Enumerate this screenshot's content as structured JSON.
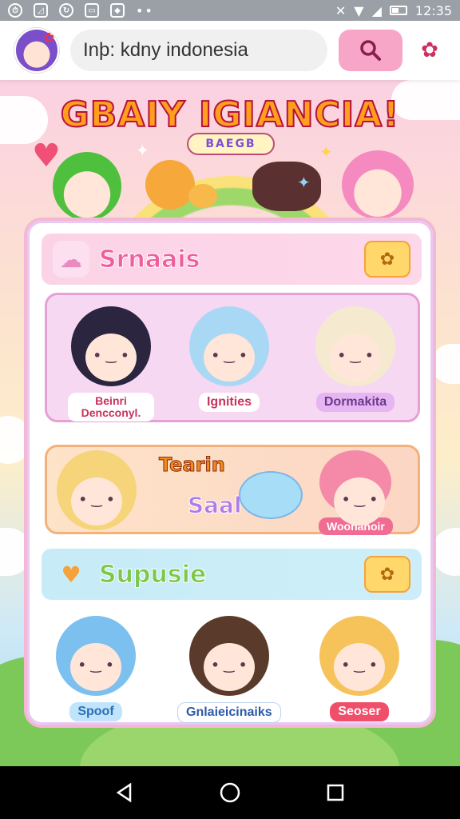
{
  "status_bar": {
    "time": "12:35",
    "icons": [
      "clock-icon",
      "gallery-icon",
      "sync-icon",
      "message-icon",
      "shield-icon",
      "more-dots-icon",
      "vibrate-icon",
      "wifi-icon",
      "signal-icon",
      "battery-icon"
    ]
  },
  "header": {
    "search_text": "Inþ: kdny indonesia",
    "search_icon": "search-icon",
    "settings_icon": "flower-gear-icon"
  },
  "banner": {
    "title": "GBAIY IGIANCIA!",
    "subtitle": "BAEGB"
  },
  "section1": {
    "title": "Srnaais",
    "characters": [
      {
        "name": "Beinri Dencconyl.",
        "hair": "#2b2540",
        "tag_bg": "#ffffff",
        "tag_color": "#c9325d"
      },
      {
        "name": "Ignities",
        "hair": "#a9d8f5",
        "tag_bg": "#ffffff",
        "tag_color": "#c9325d"
      },
      {
        "name": "Dormakita",
        "hair": "#f5ead0",
        "tag_bg": "#e6b6f2",
        "tag_color": "#6a3a8a"
      }
    ]
  },
  "section2": {
    "label_top": "Tearin",
    "label_mid": "Saal",
    "characters": [
      {
        "name": "",
        "hair": "#f6d47a"
      },
      {
        "name": "Woonahoir",
        "hair": "#f58aa8",
        "tag_bg": "#f06c93",
        "tag_color": "#ffffff"
      }
    ]
  },
  "section3": {
    "title": "Supusie",
    "characters": [
      {
        "name": "Spoof",
        "hair": "#7cc0ef",
        "tag_bg": "#bfe4fb",
        "tag_color": "#2d6fb4"
      },
      {
        "name": "Gnlaieicinaiks",
        "hair": "#5a3a2a",
        "tag_bg": "#ffffff",
        "tag_color": "#2d5aa8"
      },
      {
        "name": "Seoser",
        "hair": "#f6c35a",
        "tag_bg": "#f04f6b",
        "tag_color": "#ffffff"
      }
    ]
  },
  "nav": {
    "back_icon": "back-triangle-icon",
    "home_icon": "home-circle-icon",
    "recents_icon": "recents-square-icon"
  }
}
